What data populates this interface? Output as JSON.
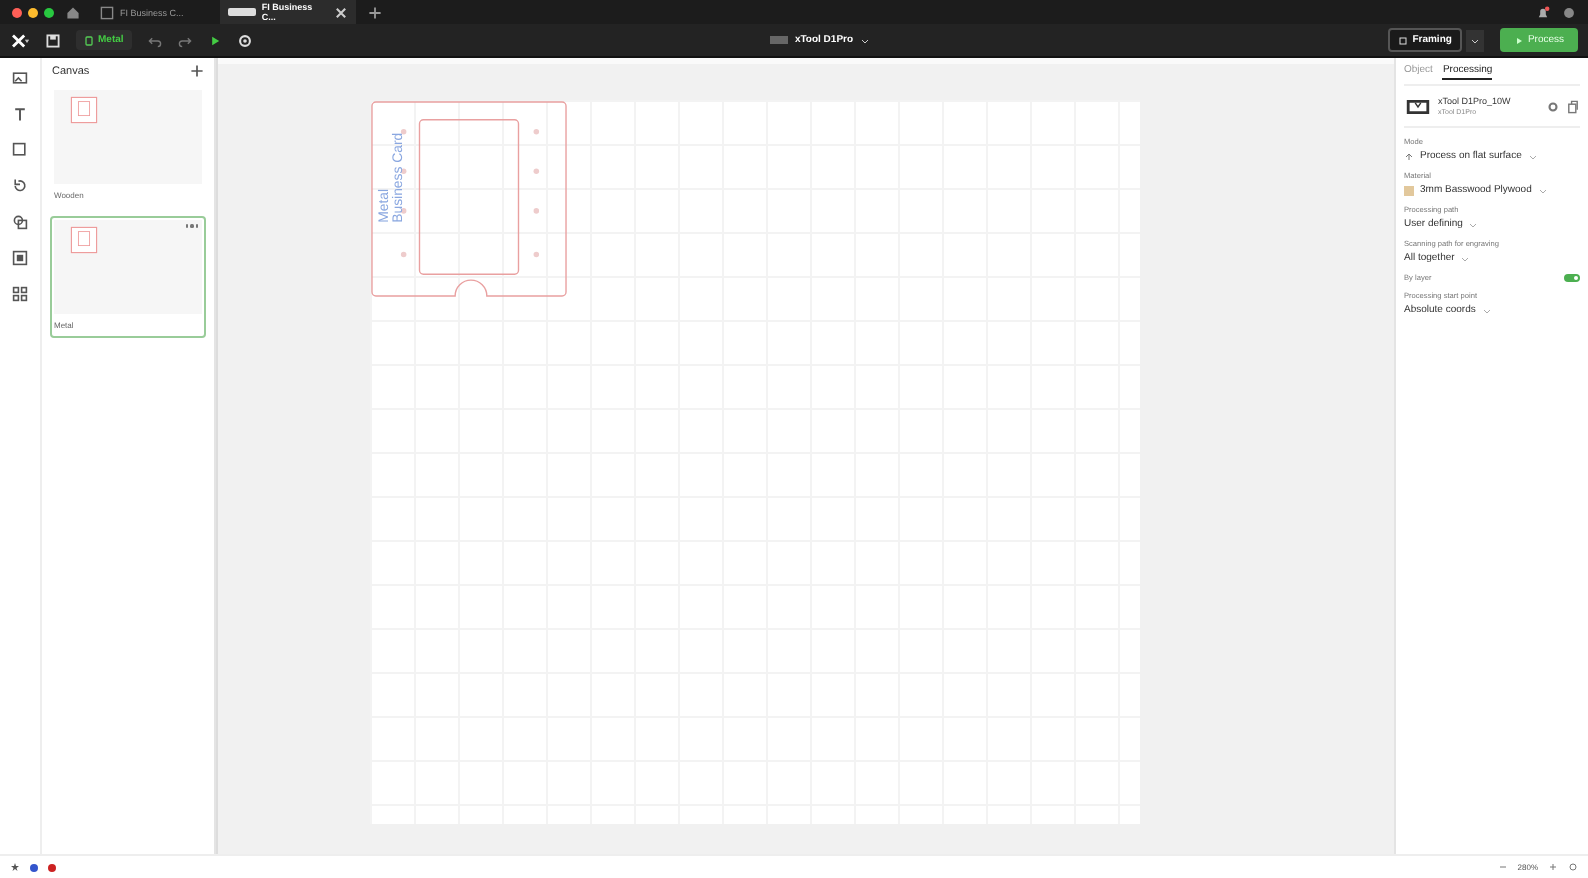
{
  "tabs": [
    {
      "label": "FI Business C...",
      "selected": false,
      "badge": false
    },
    {
      "label": "FI Business C...",
      "selected": true,
      "badge": true
    }
  ],
  "toolbar": {
    "material": "Metal",
    "device": "xTool D1Pro",
    "framing": "Framing",
    "process": "Process"
  },
  "canvas_panel": {
    "title": "Canvas",
    "canvases": [
      {
        "name": "Wooden",
        "selected": false
      },
      {
        "name": "Metal",
        "selected": true
      }
    ]
  },
  "design": {
    "lines": [
      "Metal",
      "Business Card"
    ]
  },
  "right_panel": {
    "tabs": [
      {
        "label": "Object",
        "selected": false
      },
      {
        "label": "Processing",
        "selected": true
      }
    ],
    "device": {
      "name": "xTool D1Pro_10W",
      "model": "xTool D1Pro"
    },
    "settings": [
      {
        "kind": "select",
        "label": "Mode",
        "value": "Process on flat surface"
      },
      {
        "kind": "select",
        "label": "Material",
        "value": "3mm Basswood Plywood"
      },
      {
        "kind": "select",
        "label": "Processing path",
        "value": "User defining"
      },
      {
        "kind": "select",
        "label": "Scanning path for engraving",
        "value": "All together"
      },
      {
        "kind": "toggle",
        "label": "By layer",
        "on": true
      },
      {
        "kind": "select",
        "label": "Processing start point",
        "value": "Absolute coords"
      }
    ]
  },
  "status_bar": {
    "zoom": "280%"
  }
}
